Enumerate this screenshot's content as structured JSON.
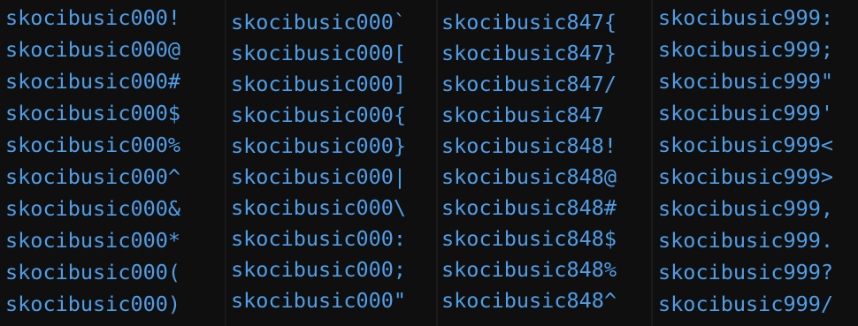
{
  "terminal": {
    "text_color": "#4f9ee8",
    "background": "#0f0f0f",
    "columns": [
      {
        "lines": [
          "skocibusic000!",
          "skocibusic000@",
          "skocibusic000#",
          "skocibusic000$",
          "skocibusic000%",
          "skocibusic000^",
          "skocibusic000&",
          "skocibusic000*",
          "skocibusic000(",
          "skocibusic000)"
        ]
      },
      {
        "lines": [
          "skocibusic000`",
          "skocibusic000[",
          "skocibusic000]",
          "skocibusic000{",
          "skocibusic000}",
          "skocibusic000|",
          "skocibusic000\\",
          "skocibusic000:",
          "skocibusic000;",
          "skocibusic000\""
        ]
      },
      {
        "lines": [
          "skocibusic847{",
          "skocibusic847}",
          "skocibusic847/",
          "skocibusic847",
          "skocibusic848!",
          "skocibusic848@",
          "skocibusic848#",
          "skocibusic848$",
          "skocibusic848%",
          "skocibusic848^"
        ]
      },
      {
        "lines": [
          "skocibusic999:",
          "skocibusic999;",
          "skocibusic999\"",
          "skocibusic999'",
          "skocibusic999<",
          "skocibusic999>",
          "skocibusic999,",
          "skocibusic999.",
          "skocibusic999?",
          "skocibusic999/"
        ]
      }
    ]
  }
}
